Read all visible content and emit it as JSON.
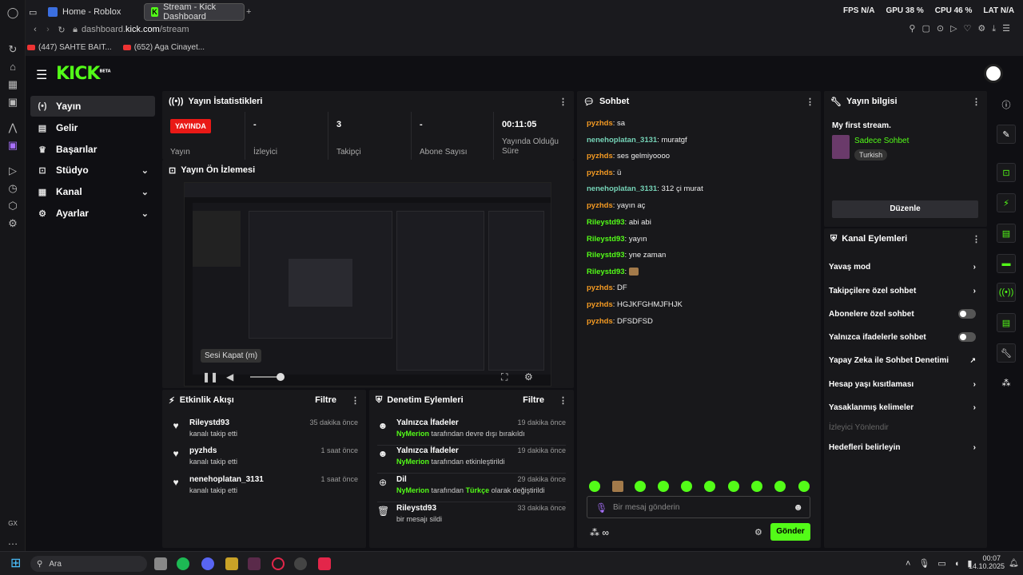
{
  "browser": {
    "tabs": [
      {
        "label": "Home - Roblox"
      },
      {
        "label": "Stream - Kick Dashboard"
      }
    ],
    "new_tab_icon": "plus-icon",
    "address": {
      "prefix": "dashboard.",
      "domain": "kick.com",
      "path": "/stream"
    },
    "bookmarks": [
      {
        "label": "(447) SAHTE BAIT..."
      },
      {
        "label": "(652) Aga Cinayet..."
      }
    ],
    "perf": {
      "fps_label": "FPS",
      "fps_value": "N/A",
      "gpu_label": "GPU",
      "gpu_value": "38 %",
      "cpu_label": "CPU",
      "cpu_value": "46 %",
      "lat_label": "LAT",
      "lat_value": "N/A"
    },
    "rail_gx": "GX"
  },
  "logo": {
    "text": "KICK",
    "beta": "BETA"
  },
  "sidebar": {
    "items": [
      {
        "label": "Yayın",
        "icon": "broadcast-icon"
      },
      {
        "label": "Gelir",
        "icon": "revenue-icon"
      },
      {
        "label": "Başarılar",
        "icon": "trophy-icon"
      },
      {
        "label": "Stüdyo",
        "icon": "studio-icon"
      },
      {
        "label": "Kanal",
        "icon": "channel-icon"
      },
      {
        "label": "Ayarlar",
        "icon": "gear-icon"
      }
    ]
  },
  "stats": {
    "title": "Yayın İstatistikleri",
    "live_badge": "YAYINDA",
    "live_label": "Yayın",
    "items": [
      {
        "value": "-",
        "label": "İzleyici"
      },
      {
        "value": "3",
        "label": "Takipçi"
      },
      {
        "value": "-",
        "label": "Abone Sayısı"
      },
      {
        "value": "00:11:05",
        "label": "Yayında Olduğu Süre"
      }
    ]
  },
  "preview": {
    "title": "Yayın Ön İzlemesi",
    "tooltip": "Sesi Kapat (m)"
  },
  "activity": {
    "title": "Etkinlik Akışı",
    "filter": "Filtre",
    "rows": [
      {
        "user": "Rileystd93",
        "action": "kanalı takip etti",
        "time": "35 dakika önce"
      },
      {
        "user": "pyzhds",
        "action": "kanalı takip etti",
        "time": "1 saat önce"
      },
      {
        "user": "nenehoplatan_3131",
        "action": "kanalı takip etti",
        "time": "1 saat önce"
      }
    ]
  },
  "moderation": {
    "title": "Denetim Eylemleri",
    "filter": "Filtre",
    "rows": [
      {
        "title": "Yalnızca İfadeler",
        "mod": "NyMerion",
        "rest": " tarafından devre dışı bırakıldı",
        "time": "19 dakika önce",
        "icon": "smile-icon"
      },
      {
        "title": "Yalnızca İfadeler",
        "mod": "NyMerion",
        "rest": " tarafından etkinleştirildi",
        "time": "19 dakika önce",
        "icon": "smile-icon"
      },
      {
        "title": "Dil",
        "mod": "NyMerion",
        "rest": " tarafından ",
        "lang": "Türkçe",
        "rest2": " olarak değiştirildi",
        "time": "29 dakika önce",
        "icon": "globe-icon"
      },
      {
        "title": "Rileystd93",
        "mod": "",
        "rest": "bir mesajı sildi",
        "time": "33 dakika önce",
        "icon": "trash-icon"
      }
    ]
  },
  "chat": {
    "title": "Sohbet",
    "messages": [
      {
        "user": "pyzhds",
        "text": "sa",
        "color": "orange"
      },
      {
        "user": "nenehoplatan_3131",
        "text": "muratgf",
        "color": "teal"
      },
      {
        "user": "pyzhds",
        "text": "ses gelmiyoooo",
        "color": "orange"
      },
      {
        "user": "pyzhds",
        "text": "ü",
        "color": "orange"
      },
      {
        "user": "nenehoplatan_3131",
        "text": "312 çi murat",
        "color": "teal"
      },
      {
        "user": "pyzhds",
        "text": "yayın aç",
        "color": "orange"
      },
      {
        "user": "Rileystd93",
        "text": "abi abi",
        "color": "green"
      },
      {
        "user": "Rileystd93",
        "text": "yayın",
        "color": "green"
      },
      {
        "user": "Rileystd93",
        "text": "yne zaman",
        "color": "green"
      },
      {
        "user": "Rileystd93",
        "text": "",
        "color": "green"
      },
      {
        "user": "pyzhds",
        "text": "DF",
        "color": "orange"
      },
      {
        "user": "pyzhds",
        "text": "HGJKFGHMJFHJK",
        "color": "orange"
      },
      {
        "user": "pyzhds",
        "text": "DFSDFSD",
        "color": "orange"
      }
    ],
    "input_placeholder": "Bir mesaj gönderin",
    "send": "Gönder"
  },
  "stream_info": {
    "title": "Yayın bilgisi",
    "stream_title": "My first stream.",
    "category": "Sadece Sohbet",
    "language": "Turkish",
    "edit": "Düzenle"
  },
  "channel_actions": {
    "title": "Kanal Eylemleri",
    "items": [
      {
        "label": "Yavaş mod",
        "kind": "chevron"
      },
      {
        "label": "Takipçilere özel sohbet",
        "kind": "chevron"
      },
      {
        "label": "Abonelere özel sohbet",
        "kind": "toggle"
      },
      {
        "label": "Yalnızca ifadelerle sohbet",
        "kind": "toggle"
      },
      {
        "label": "Yapay Zeka ile Sohbet Denetimi",
        "kind": "external"
      },
      {
        "label": "Hesap yaşı kısıtlaması",
        "kind": "chevron"
      },
      {
        "label": "Yasaklanmış kelimeler",
        "kind": "chevron"
      },
      {
        "label": "İzleyici Yönlendir",
        "kind": "disabled"
      },
      {
        "label": "Hedefleri belirleyin",
        "kind": "chevron"
      }
    ]
  },
  "taskbar": {
    "search": "Ara",
    "time": "00:07",
    "date": "14.10.2025"
  }
}
